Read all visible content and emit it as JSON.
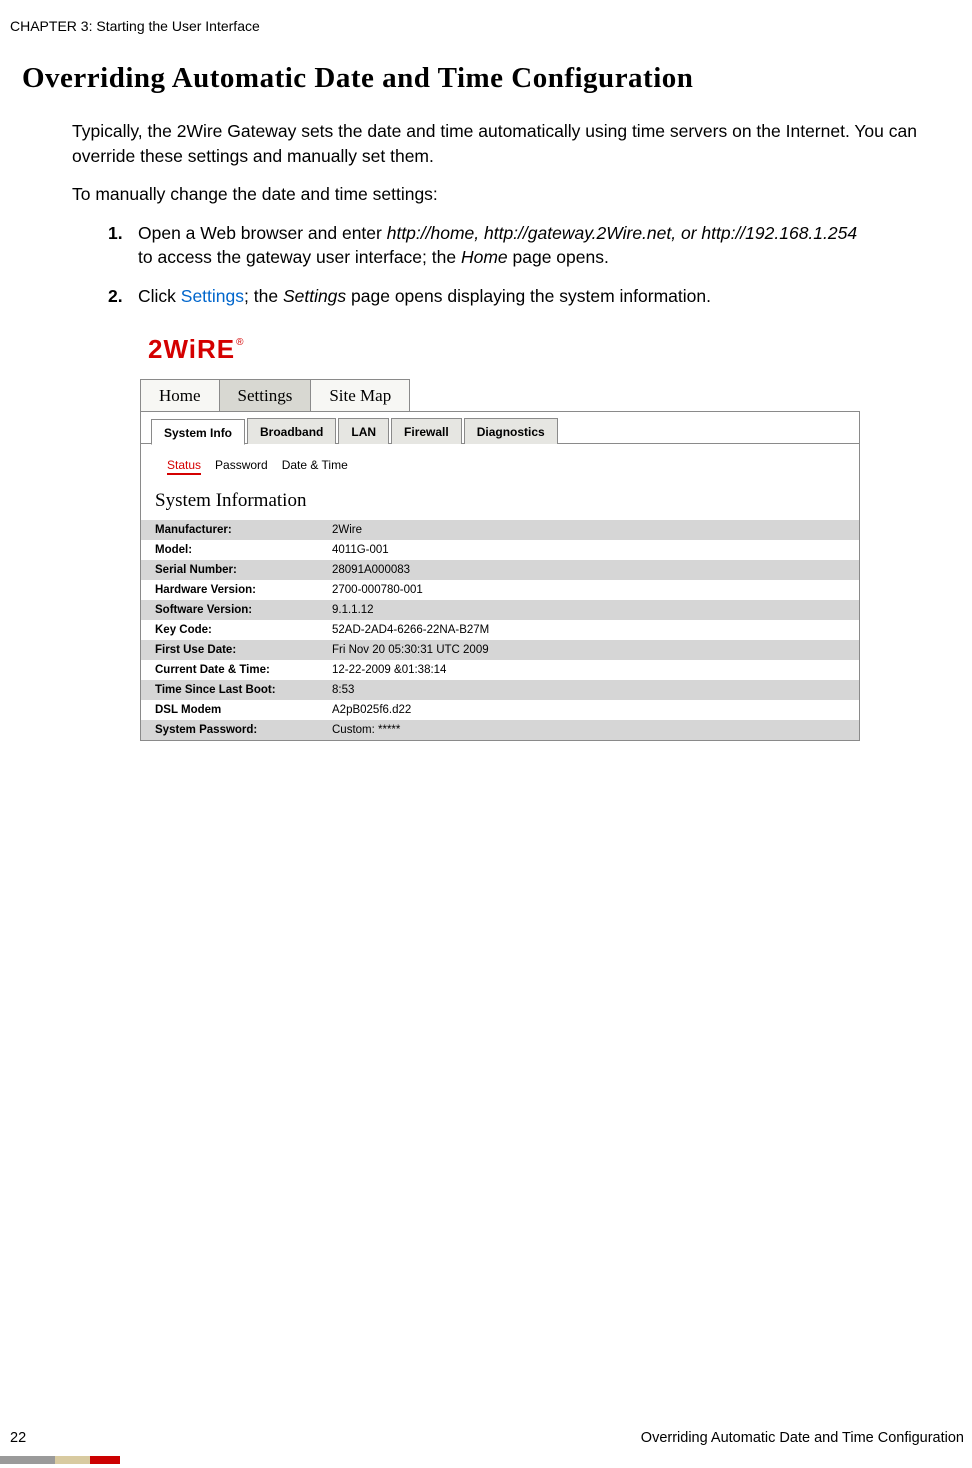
{
  "chapter_header": "CHAPTER 3: Starting the User Interface",
  "heading": "Overriding Automatic Date and Time Configuration",
  "para1": "Typically, the 2Wire Gateway sets the date and time automatically using time servers on the Internet. You can override these settings and manually set them.",
  "para2": "To manually change the date and time settings:",
  "steps": {
    "s1num": "1.",
    "s1a": "Open a Web browser and enter ",
    "s1b": "http://home, http://gateway.2Wire.net, or http://192.168.1.254",
    "s1c": " to access the gateway user interface; the ",
    "s1d": "Home",
    "s1e": " page opens.",
    "s2num": "2.",
    "s2a": "Click ",
    "s2b": "Settings",
    "s2c": "; the ",
    "s2d": "Settings",
    "s2e": " page opens displaying the system information."
  },
  "logo_text": "2WiRE",
  "logo_r": "®",
  "topnav": {
    "home": "Home",
    "settings": "Settings",
    "sitemap": "Site Map"
  },
  "subtabs": {
    "sysinfo": "System Info",
    "broadband": "Broadband",
    "lan": "LAN",
    "firewall": "Firewall",
    "diagnostics": "Diagnostics"
  },
  "sublinks": {
    "status": "Status",
    "password": "Password",
    "datetime": "Date & Time"
  },
  "section_title": "System Information",
  "rows": [
    {
      "k": "Manufacturer:",
      "v": "2Wire"
    },
    {
      "k": "Model:",
      "v": "4011G-001"
    },
    {
      "k": "Serial Number:",
      "v": "28091A000083"
    },
    {
      "k": "Hardware Version:",
      "v": "2700-000780-001"
    },
    {
      "k": "Software Version:",
      "v": "9.1.1.12"
    },
    {
      "k": "Key Code:",
      "v": "52AD-2AD4-6266-22NA-B27M"
    },
    {
      "k": "First Use Date:",
      "v": "Fri Nov 20 05:30:31 UTC 2009"
    },
    {
      "k": "Current Date & Time:",
      "v": "12-22-2009 &01:38:14"
    },
    {
      "k": "Time Since Last Boot:",
      "v": "8:53"
    },
    {
      "k": "DSL Modem",
      "v": "A2pB025f6.d22"
    },
    {
      "k": "System Password:",
      "v": "Custom: *****"
    }
  ],
  "footer": {
    "page": "22",
    "title": "Overriding Automatic Date and Time Configuration"
  }
}
